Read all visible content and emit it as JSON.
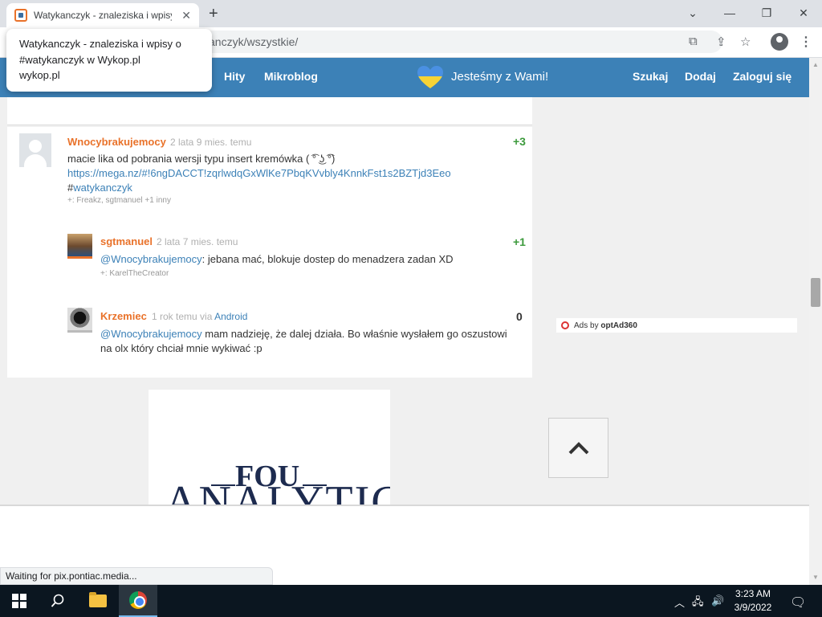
{
  "browser": {
    "tab_title": "Watykanczyk - znaleziska i wpisy",
    "tab_close": "✕",
    "new_tab": "+",
    "url_visible": "anczyk/wszystkie/",
    "tooltip": {
      "line1": "Watykanczyk - znaleziska i wpisy o",
      "line2": "#watykanczyk w Wykop.pl",
      "line3": "wykop.pl"
    },
    "status": "Waiting for pix.pontiac.media..."
  },
  "header": {
    "nav": [
      "Hity",
      "Mikroblog"
    ],
    "ukraine": "Jesteśmy z Wami!",
    "right_nav": [
      "Szukaj",
      "Dodaj",
      "Zaloguj się"
    ],
    "colors": {
      "bar": "#3c81b7",
      "author": "#e9722a"
    }
  },
  "comments": [
    {
      "author": "Wnocybrakujemocy",
      "time": "2 lata 9 mies. temu",
      "vote": "+3",
      "text": "macie lika od pobrania wersji typu insert kremówka ( ͡° ͜ʖ ͡°)",
      "link": "https://mega.nz/#!6ngDACCT!zqrlwdqGxWlKe7PbqKVvbly4KnnkFst1s2BZTjd3Eeo",
      "hash_prefix": "#",
      "hashtag": "watykanczyk",
      "plus": "+: Freakz, sgtmanuel +1 inny"
    },
    {
      "author": "sgtmanuel",
      "time": "2 lata 7 mies. temu",
      "vote": "+1",
      "mention": "@Wnocybrakujemocy",
      "text": ": jebana mać, blokuje dostep do menadzera zadan XD",
      "plus": "+: KarelTheCreator"
    },
    {
      "author": "Krzemiec",
      "time": "1 rok temu",
      "via": "via",
      "via_app": "Android",
      "vote": "0",
      "mention": "@Wnocybrakujemocy",
      "text1": " mam nadzieję, że dalej działa. Bo właśnie wysłałem go oszustowi",
      "text2": "na olx który chciał mnie wykiwać :p"
    }
  ],
  "ads": {
    "label": "Ads by",
    "brand": "optAd360",
    "banner_top": "FOU",
    "banner_bottom": "ANALYTICS"
  },
  "taskbar": {
    "time": "3:23 AM",
    "date": "3/9/2022"
  }
}
